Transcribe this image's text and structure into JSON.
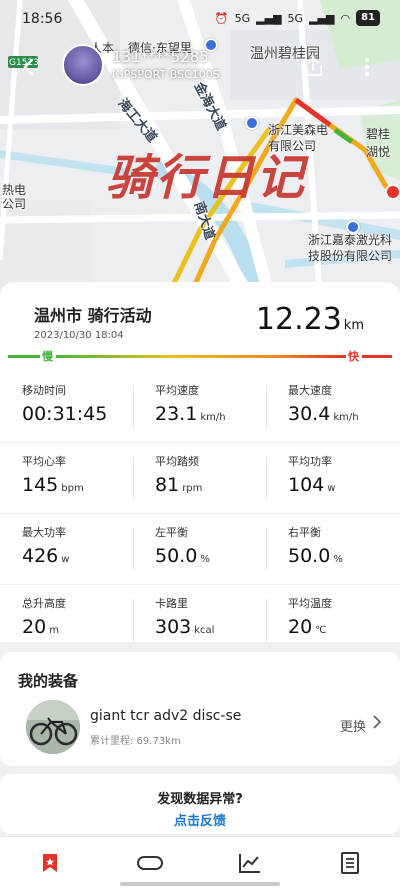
{
  "status_bar": {
    "time": "18:56",
    "battery": "81",
    "signal_labels": [
      "5G",
      "5G"
    ]
  },
  "map": {
    "labels": {
      "person_text": "人本",
      "street_1": "德信·东望里",
      "community_1": "温州碧桂园",
      "company_1_line1": "浙江美森电",
      "company_1_line2": "有限公司",
      "lake_line1": "碧桂",
      "lake_line2": "湖悦",
      "left_line1": "热电",
      "left_line2": "公司",
      "road_1": "金海大道",
      "road_2": "海工大道",
      "road_3": "南大道",
      "company_2_line1": "浙江嘉泰激光科",
      "company_2_line2": "技股份有限公司",
      "route_badge": "G1523"
    },
    "watermark": "骑行日记"
  },
  "header": {
    "back_icon": "back-arrow-icon",
    "user_name": "131****5285",
    "device_name": "IGPSPORT BSC100S",
    "share_icon": "share-icon",
    "more_icon": "more-icon"
  },
  "summary": {
    "title": "温州市 骑行活动",
    "date": "2023/10/30 18:04",
    "distance": "12.23",
    "distance_unit": "km",
    "slow_label": "慢",
    "fast_label": "快",
    "colors": {
      "green": "#47b33c",
      "yellow": "#e8c21e",
      "orange": "#f08a1d",
      "red": "#e5332a"
    }
  },
  "metrics": [
    [
      {
        "label": "移动时间",
        "value": "00:31:45",
        "unit": ""
      },
      {
        "label": "平均速度",
        "value": "23.1",
        "unit": "km/h"
      },
      {
        "label": "最大速度",
        "value": "30.4",
        "unit": "km/h"
      }
    ],
    [
      {
        "label": "平均心率",
        "value": "145",
        "unit": "bpm"
      },
      {
        "label": "平均踏频",
        "value": "81",
        "unit": "rpm"
      },
      {
        "label": "平均功率",
        "value": "104",
        "unit": "w"
      }
    ],
    [
      {
        "label": "最大功率",
        "value": "426",
        "unit": "w"
      },
      {
        "label": "左平衡",
        "value": "50.0",
        "unit": "%"
      },
      {
        "label": "右平衡",
        "value": "50.0",
        "unit": "%"
      }
    ],
    [
      {
        "label": "总升高度",
        "value": "20",
        "unit": "m"
      },
      {
        "label": "卡路里",
        "value": "303",
        "unit": "kcal"
      },
      {
        "label": "平均温度",
        "value": "20",
        "unit": "℃"
      }
    ]
  ],
  "equipment": {
    "title": "我的装备",
    "bike_name": "giant tcr adv2 disc-se",
    "mileage": "累计里程: 69.73km",
    "change_label": "更换"
  },
  "feedback": {
    "question": "发现数据异常?",
    "link": "点击反馈"
  },
  "bottom_nav": [
    {
      "icon": "bookmark-icon",
      "active": true,
      "color": "#e5332a"
    },
    {
      "icon": "route-icon",
      "active": false
    },
    {
      "icon": "chart-icon",
      "active": false
    },
    {
      "icon": "document-icon",
      "active": false
    }
  ]
}
